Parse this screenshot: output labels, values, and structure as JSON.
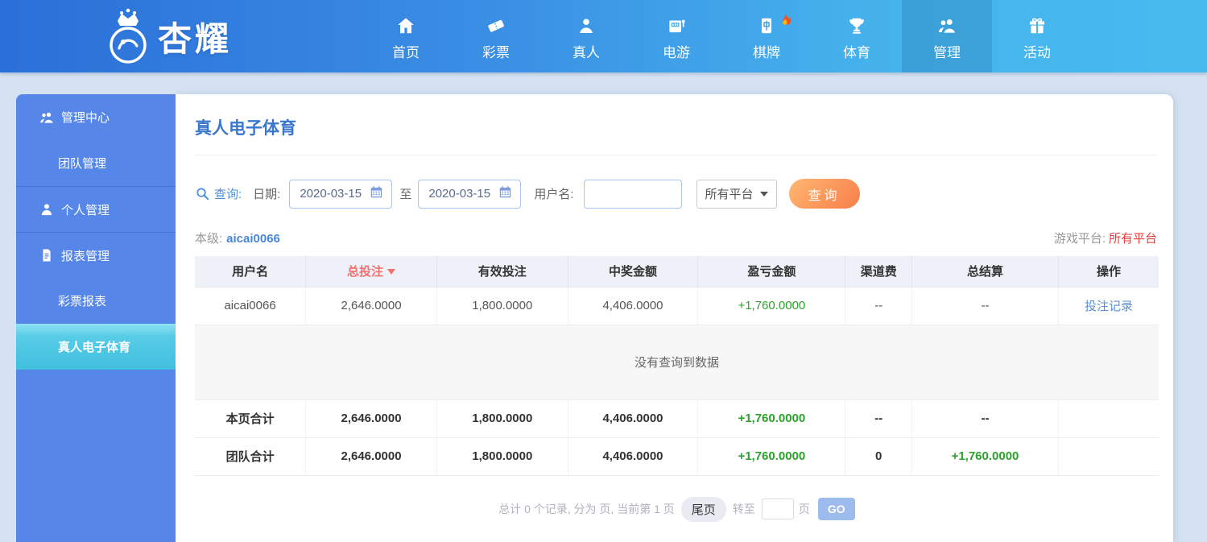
{
  "brand": {
    "name": "杏耀"
  },
  "navbar": {
    "items": [
      {
        "label": "首页"
      },
      {
        "label": "彩票"
      },
      {
        "label": "真人"
      },
      {
        "label": "电游"
      },
      {
        "label": "棋牌",
        "hot": true
      },
      {
        "label": "体育"
      },
      {
        "label": "管理",
        "active": true
      },
      {
        "label": "活动"
      }
    ]
  },
  "sidebar": {
    "items": [
      {
        "label": "管理中心"
      },
      {
        "label": "团队管理"
      },
      {
        "label": "个人管理"
      },
      {
        "label": "报表管理"
      },
      {
        "label": "彩票报表"
      },
      {
        "label": "真人电子体育",
        "active": true
      }
    ]
  },
  "main": {
    "title": "真人电子体育",
    "search": {
      "query_label": "查询:",
      "date_label": "日期:",
      "date_from": "2020-03-15",
      "to_label": "至",
      "date_to": "2020-03-15",
      "username_label": "用户名:",
      "username_value": "",
      "platform_selected": "所有平台",
      "submit_label": "查询"
    },
    "level": {
      "label": "本级:",
      "value": "aicai0066"
    },
    "platform": {
      "label": "游戏平台:",
      "value": "所有平台"
    },
    "table": {
      "headers": [
        "用户名",
        "总投注",
        "有效投注",
        "中奖金额",
        "盈亏金额",
        "渠道费",
        "总结算",
        "操作"
      ],
      "sorted_header": "总投注",
      "rows": [
        {
          "cells": [
            "aicai0066",
            "2,646.0000",
            "1,800.0000",
            "4,406.0000",
            "+1,760.0000",
            "--",
            "--",
            "投注记录"
          ]
        }
      ],
      "empty_text": "没有查询到数据",
      "page_total": {
        "cells": [
          "本页合计",
          "2,646.0000",
          "1,800.0000",
          "4,406.0000",
          "+1,760.0000",
          "--",
          "--",
          ""
        ]
      },
      "team_total": {
        "cells": [
          "团队合计",
          "2,646.0000",
          "1,800.0000",
          "4,406.0000",
          "+1,760.0000",
          "0",
          "+1,760.0000",
          ""
        ]
      }
    },
    "pagination": {
      "summary": "总计 0 个记录, 分为 页, 当前第 1 页",
      "last_label": "尾页",
      "goto_label": "转至",
      "goto_value": "",
      "unit_label": "页",
      "go_label": "GO"
    }
  },
  "colors": {
    "navbar_blue_left": "#2b6fd8",
    "navbar_blue_right": "#47bbee",
    "sidebar_blue": "#5686e8",
    "active_cyan": "#4cc6e2",
    "accent_orange": "#f87d4a",
    "profit_green": "#2ba32b",
    "alert_red": "#e23c3c",
    "link_blue": "#5b8ed9",
    "title_blue": "#3a76cc",
    "sort_red": "#f0716f"
  }
}
